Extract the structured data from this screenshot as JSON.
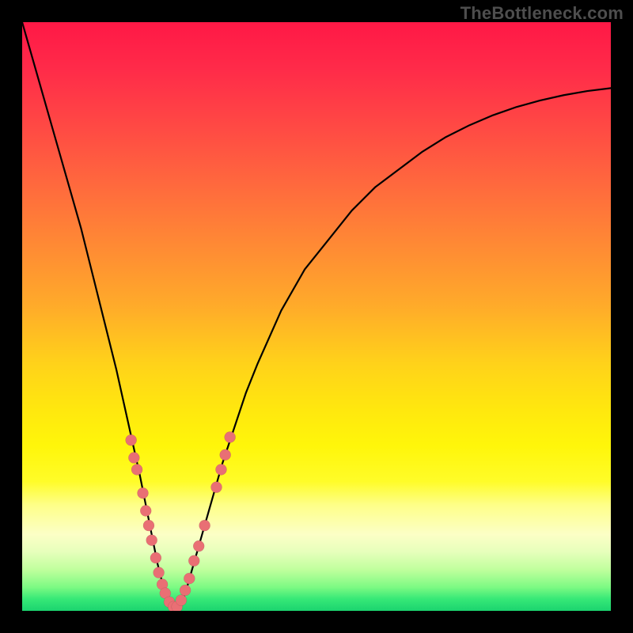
{
  "watermark": "TheBottleneck.com",
  "chart_data": {
    "type": "line",
    "title": "",
    "xlabel": "",
    "ylabel": "",
    "ylim": [
      0,
      100
    ],
    "xlim": [
      0,
      100
    ],
    "series": [
      {
        "name": "curve",
        "x": [
          0,
          2,
          4,
          6,
          8,
          10,
          12,
          14,
          16,
          18,
          20,
          21,
          22,
          23,
          24,
          25,
          26,
          27,
          28,
          30,
          32,
          34,
          36,
          38,
          40,
          44,
          48,
          52,
          56,
          60,
          64,
          68,
          72,
          76,
          80,
          84,
          88,
          92,
          96,
          100
        ],
        "y": [
          100,
          93,
          86,
          79,
          72,
          65,
          57,
          49,
          41,
          32,
          23,
          18,
          13,
          8,
          4,
          1,
          0,
          1,
          4,
          11,
          18,
          25,
          31,
          37,
          42,
          51,
          58,
          63,
          68,
          72,
          75,
          78,
          80.5,
          82.5,
          84.2,
          85.6,
          86.7,
          87.6,
          88.3,
          88.8
        ]
      }
    ],
    "markers": {
      "name": "highlight",
      "color": "#e96f74",
      "points": [
        {
          "x": 18.5,
          "y": 29
        },
        {
          "x": 19.0,
          "y": 26
        },
        {
          "x": 19.5,
          "y": 24
        },
        {
          "x": 20.5,
          "y": 20
        },
        {
          "x": 21.0,
          "y": 17
        },
        {
          "x": 21.5,
          "y": 14.5
        },
        {
          "x": 22.0,
          "y": 12
        },
        {
          "x": 22.7,
          "y": 9
        },
        {
          "x": 23.2,
          "y": 6.5
        },
        {
          "x": 23.8,
          "y": 4.5
        },
        {
          "x": 24.3,
          "y": 3
        },
        {
          "x": 25.0,
          "y": 1.5
        },
        {
          "x": 25.7,
          "y": 0.7
        },
        {
          "x": 26.3,
          "y": 0.7
        },
        {
          "x": 27.0,
          "y": 1.8
        },
        {
          "x": 27.7,
          "y": 3.5
        },
        {
          "x": 28.4,
          "y": 5.5
        },
        {
          "x": 29.2,
          "y": 8.5
        },
        {
          "x": 30.0,
          "y": 11
        },
        {
          "x": 31.0,
          "y": 14.5
        },
        {
          "x": 33.0,
          "y": 21
        },
        {
          "x": 33.8,
          "y": 24
        },
        {
          "x": 34.5,
          "y": 26.5
        },
        {
          "x": 35.3,
          "y": 29.5
        }
      ]
    },
    "background_gradient": {
      "top": "#ff1846",
      "middle": "#ffe80e",
      "bottom": "#1bd46f"
    }
  }
}
